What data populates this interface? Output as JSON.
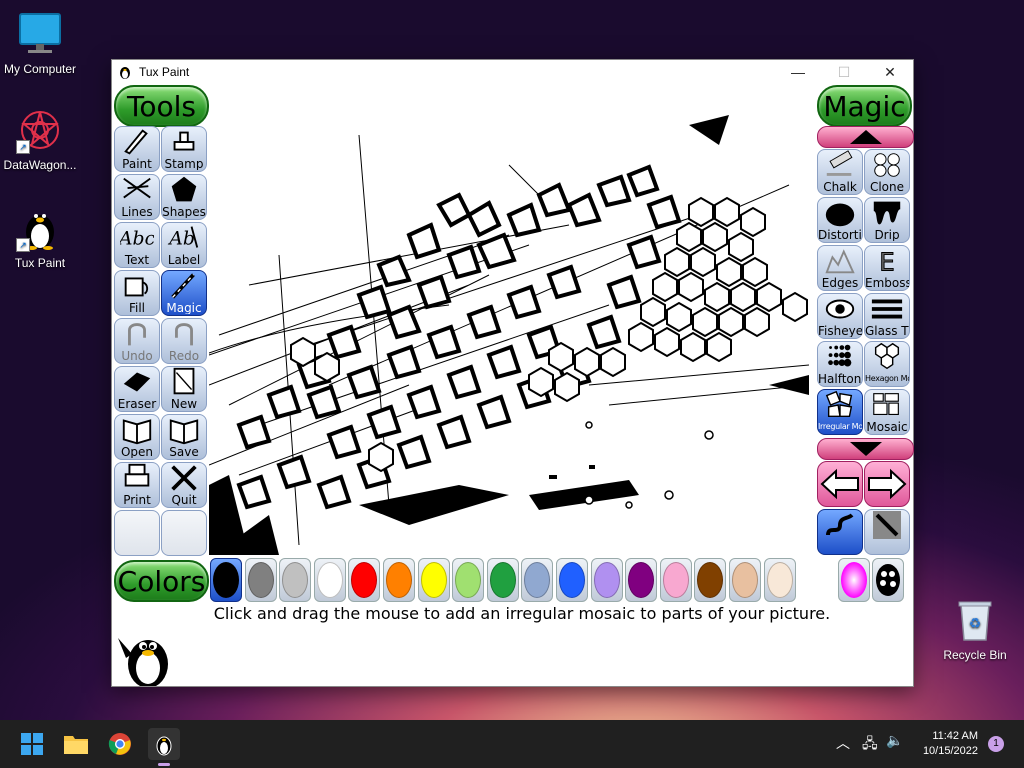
{
  "desktop": {
    "icons": [
      {
        "label": "My Computer",
        "icon": "monitor-icon"
      },
      {
        "label": "DataWagon...",
        "icon": "datawagon-icon"
      },
      {
        "label": "Tux Paint",
        "icon": "tux-icon"
      },
      {
        "label": "Recycle Bin",
        "icon": "recycle-bin-icon"
      }
    ]
  },
  "window": {
    "title": "Tux Paint",
    "controls": {
      "minimize": "—",
      "maximize": "☐",
      "close": "✕"
    }
  },
  "tools": {
    "header": "Tools",
    "items": [
      {
        "label": "Paint",
        "icon": "paintbrush-icon",
        "state": "normal"
      },
      {
        "label": "Stamp",
        "icon": "stamp-icon",
        "state": "normal"
      },
      {
        "label": "Lines",
        "icon": "lines-icon",
        "state": "normal"
      },
      {
        "label": "Shapes",
        "icon": "pentagon-icon",
        "state": "normal"
      },
      {
        "label": "Text",
        "icon": "text-icon",
        "state": "normal"
      },
      {
        "label": "Label",
        "icon": "label-icon",
        "state": "normal"
      },
      {
        "label": "Fill",
        "icon": "paint-bucket-icon",
        "state": "normal"
      },
      {
        "label": "Magic",
        "icon": "magic-wand-icon",
        "state": "selected"
      },
      {
        "label": "Undo",
        "icon": "undo-icon",
        "state": "disabled"
      },
      {
        "label": "Redo",
        "icon": "redo-icon",
        "state": "disabled"
      },
      {
        "label": "Eraser",
        "icon": "eraser-icon",
        "state": "normal"
      },
      {
        "label": "New",
        "icon": "new-page-icon",
        "state": "normal"
      },
      {
        "label": "Open",
        "icon": "open-book-icon",
        "state": "normal"
      },
      {
        "label": "Save",
        "icon": "save-book-icon",
        "state": "normal"
      },
      {
        "label": "Print",
        "icon": "printer-icon",
        "state": "normal"
      },
      {
        "label": "Quit",
        "icon": "quit-icon",
        "state": "normal"
      }
    ]
  },
  "magic": {
    "header": "Magic",
    "items": [
      {
        "label": "Chalk",
        "icon": "chalk-icon",
        "state": "normal"
      },
      {
        "label": "Clone",
        "icon": "clone-sheep-icon",
        "state": "normal"
      },
      {
        "label": "Distortion",
        "icon": "distortion-icon",
        "state": "normal"
      },
      {
        "label": "Drip",
        "icon": "drip-icon",
        "state": "normal"
      },
      {
        "label": "Edges",
        "icon": "edges-icon",
        "state": "normal"
      },
      {
        "label": "Emboss",
        "icon": "emboss-icon",
        "state": "normal"
      },
      {
        "label": "Fisheye",
        "icon": "fisheye-icon",
        "state": "normal"
      },
      {
        "label": "Glass Tile",
        "icon": "glass-tile-icon",
        "state": "normal"
      },
      {
        "label": "Halftone",
        "icon": "halftone-icon",
        "state": "normal"
      },
      {
        "label": "Hexagon Mosaic",
        "icon": "hexagon-mosaic-icon",
        "state": "normal"
      },
      {
        "label": "Irregular Mosaic",
        "icon": "irregular-mosaic-icon",
        "state": "selected"
      },
      {
        "label": "Mosaic",
        "icon": "mosaic-icon",
        "state": "normal"
      }
    ]
  },
  "colors": {
    "header": "Colors",
    "swatches": [
      "#000000",
      "#808080",
      "#c0c0c0",
      "#ffffff",
      "#ff0000",
      "#ff8000",
      "#ffff00",
      "#a0e070",
      "#20a040",
      "#90a8d0",
      "#2060ff",
      "#b090f0",
      "#800080",
      "#f8a8d0",
      "#804000",
      "#e8c0a0",
      "#f8e8d8"
    ],
    "selected_index": 0
  },
  "instruction": "Click and drag the mouse to add an irregular mosaic to parts of your picture.",
  "taskbar": {
    "apps": [
      "windows-start-icon",
      "file-explorer-icon",
      "chrome-icon",
      "tux-paint-taskbar-icon"
    ],
    "time": "11:42 AM",
    "date": "10/15/2022",
    "notification_count": "1"
  }
}
